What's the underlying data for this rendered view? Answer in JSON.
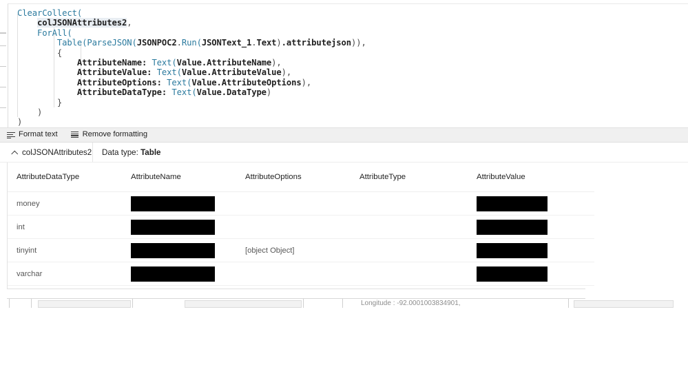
{
  "formula": {
    "lines": [
      [
        {
          "t": "ClearCollect(",
          "c": "fn"
        }
      ],
      [
        {
          "t": "    ",
          "c": "plain"
        },
        {
          "t": "colJSONAttributes2",
          "c": "ident hl"
        },
        {
          "t": ",",
          "c": "punct"
        }
      ],
      [
        {
          "t": "    ",
          "c": "plain"
        },
        {
          "t": "ForAll(",
          "c": "fn"
        }
      ],
      [
        {
          "t": "        ",
          "c": "plain"
        },
        {
          "t": "Table(ParseJSON(",
          "c": "fn"
        },
        {
          "t": "JSONPOC2",
          "c": "ident"
        },
        {
          "t": ".",
          "c": "punct"
        },
        {
          "t": "Run(",
          "c": "fn"
        },
        {
          "t": "JSONText_1",
          "c": "ident"
        },
        {
          "t": ".",
          "c": "punct"
        },
        {
          "t": "Text",
          "c": "ident"
        },
        {
          "t": ")",
          "c": "punct"
        },
        {
          "t": ".attributejson",
          "c": "ident"
        },
        {
          "t": ")),",
          "c": "punct"
        }
      ],
      [
        {
          "t": "        {",
          "c": "punct"
        }
      ],
      [
        {
          "t": "            ",
          "c": "plain"
        },
        {
          "t": "AttributeName:",
          "c": "ident"
        },
        {
          "t": " ",
          "c": "plain"
        },
        {
          "t": "Text(",
          "c": "fn"
        },
        {
          "t": "Value.AttributeName",
          "c": "ident"
        },
        {
          "t": "),",
          "c": "punct"
        }
      ],
      [
        {
          "t": "            ",
          "c": "plain"
        },
        {
          "t": "AttributeValue:",
          "c": "ident"
        },
        {
          "t": " ",
          "c": "plain"
        },
        {
          "t": "Text(",
          "c": "fn"
        },
        {
          "t": "Value.AttributeValue",
          "c": "ident"
        },
        {
          "t": "),",
          "c": "punct"
        }
      ],
      [
        {
          "t": "            ",
          "c": "plain"
        },
        {
          "t": "AttributeOptions:",
          "c": "ident"
        },
        {
          "t": " ",
          "c": "plain"
        },
        {
          "t": "Text(",
          "c": "fn"
        },
        {
          "t": "Value.AttributeOptions",
          "c": "ident"
        },
        {
          "t": "),",
          "c": "punct"
        }
      ],
      [
        {
          "t": "            ",
          "c": "plain"
        },
        {
          "t": "AttributeDataType:",
          "c": "ident"
        },
        {
          "t": " ",
          "c": "plain"
        },
        {
          "t": "Text(",
          "c": "fn"
        },
        {
          "t": "Value.DataType",
          "c": "ident"
        },
        {
          "t": ")",
          "c": "punct"
        }
      ],
      [
        {
          "t": "        }",
          "c": "punct"
        }
      ],
      [
        {
          "t": "    )",
          "c": "punct"
        }
      ],
      [
        {
          "t": ")",
          "c": "punct"
        }
      ]
    ]
  },
  "toolbar": {
    "format_text_label": "Format text",
    "remove_formatting_label": "Remove formatting",
    "format_icon": "format-text-icon",
    "remove_icon": "remove-formatting-icon"
  },
  "variable_bar": {
    "collapse_icon": "chevron-up-icon",
    "name": "colJSONAttributes2",
    "data_type_prefix": "Data type: ",
    "data_type_value": "Table"
  },
  "results_table": {
    "columns": [
      "AttributeDataType",
      "AttributeName",
      "AttributeOptions",
      "AttributeType",
      "AttributeValue"
    ],
    "rows": [
      {
        "AttributeDataType": "money",
        "AttributeName": "[redacted]",
        "AttributeOptions": "",
        "AttributeType": "",
        "AttributeValue": "[redacted]"
      },
      {
        "AttributeDataType": "int",
        "AttributeName": "[redacted]",
        "AttributeOptions": "",
        "AttributeType": "",
        "AttributeValue": "[redacted]"
      },
      {
        "AttributeDataType": "tinyint",
        "AttributeName": "[redacted]",
        "AttributeOptions": "[object Object]",
        "AttributeType": "",
        "AttributeValue": "[redacted]"
      },
      {
        "AttributeDataType": "varchar",
        "AttributeName": "[redacted]",
        "AttributeOptions": "",
        "AttributeType": "",
        "AttributeValue": "[redacted]"
      }
    ]
  },
  "bottom_strip": {
    "clipped_text": "Longitude : -92.0001003834901,"
  },
  "colors": {
    "function_blue": "#2b7a9e",
    "identifier": "#1f1f1f",
    "selection_highlight": "#e8edf2",
    "toolbar_bg": "#f0f0f0",
    "redaction": "#000000",
    "grid_line": "#f0f0f0"
  }
}
